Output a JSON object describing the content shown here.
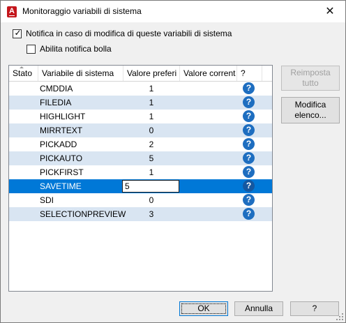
{
  "window": {
    "title": "Monitoraggio variabili di sistema",
    "close_glyph": "✕",
    "app_icon_letter": "A"
  },
  "options": {
    "notify_label": "Notifica in caso di modifica di queste variabili di sistema",
    "notify_checked": true,
    "balloon_label": "Abilita notifica bolla",
    "balloon_checked": false
  },
  "table": {
    "columns": [
      "Stato",
      "Variabile di sistema",
      "Valore preferi",
      "Valore corrent",
      "?"
    ],
    "rows": [
      {
        "name": "CMDDIA",
        "preferred": "1"
      },
      {
        "name": "FILEDIA",
        "preferred": "1"
      },
      {
        "name": "HIGHLIGHT",
        "preferred": "1"
      },
      {
        "name": "MIRRTEXT",
        "preferred": "0"
      },
      {
        "name": "PICKADD",
        "preferred": "2"
      },
      {
        "name": "PICKAUTO",
        "preferred": "5"
      },
      {
        "name": "PICKFIRST",
        "preferred": "1"
      },
      {
        "name": "SAVETIME",
        "preferred": "5",
        "selected": true,
        "editing": true
      },
      {
        "name": "SDI",
        "preferred": "0"
      },
      {
        "name": "SELECTIONPREVIEW",
        "preferred": "3"
      }
    ],
    "help_glyph": "?"
  },
  "side_buttons": {
    "reset_line1": "Reimposta",
    "reset_line2": "tutto",
    "modify_line1": "Modifica",
    "modify_line2": "elenco..."
  },
  "footer": {
    "ok_label": "OK",
    "cancel_label": "Annulla",
    "help_label": "?"
  },
  "colors": {
    "selection": "#0078d7",
    "alt_row": "#d9e5f2",
    "help_icon": "#1e6ec0",
    "app_icon": "#c4161c"
  }
}
